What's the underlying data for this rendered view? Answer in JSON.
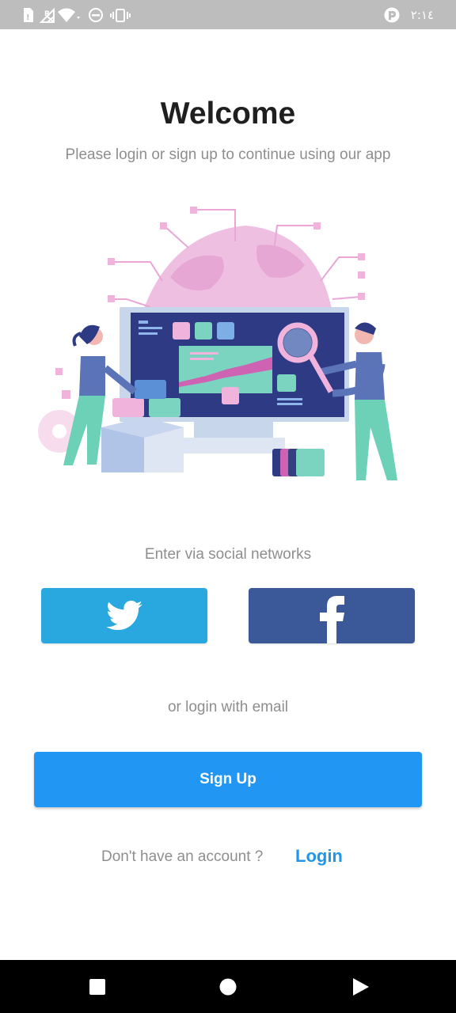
{
  "status_bar": {
    "time": "٢:١٤",
    "icons": [
      "sim-card-icon",
      "no-signal-icon",
      "wifi-icon",
      "do-not-disturb-icon",
      "vibrate-icon",
      "notification-app-icon"
    ]
  },
  "header": {
    "title": "Welcome",
    "subtitle": "Please login or sign up to continue using our app"
  },
  "illustration": {
    "icon": "world-data-analytics-illustration"
  },
  "social": {
    "label": "Enter via social networks",
    "twitter": {
      "icon": "twitter-icon",
      "color": "#29a8e0"
    },
    "facebook": {
      "icon": "facebook-icon",
      "color": "#3b5998"
    }
  },
  "email": {
    "label": "or login with email"
  },
  "signup": {
    "label": "Sign Up",
    "color": "#2196f3"
  },
  "account": {
    "text": "Don't have an account ?",
    "login_label": "Login",
    "login_color": "#2196e8"
  },
  "nav_bar": {
    "icons": [
      "recents-icon",
      "home-icon",
      "back-icon"
    ]
  }
}
